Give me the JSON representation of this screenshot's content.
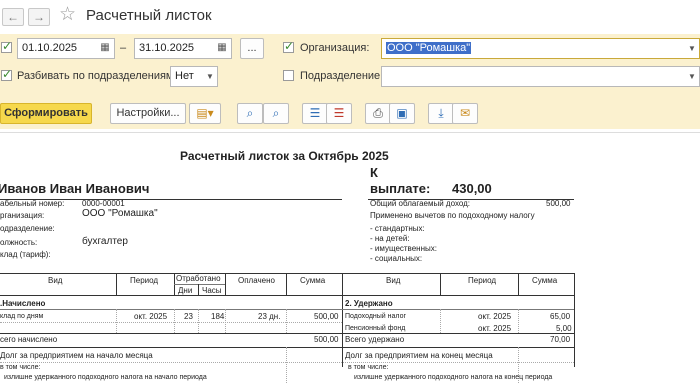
{
  "window": {
    "title": "Расчетный листок"
  },
  "nav": {
    "back": "←",
    "forward": "→",
    "star": "☆"
  },
  "params": {
    "date_from": "01.10.2025",
    "date_to": "31.10.2025",
    "dash": "–",
    "period_more": "...",
    "org_label": "Организация:",
    "org_value": "ООО \"Ромашка\"",
    "split_label": "Разбивать по подразделениям:",
    "split_value": "Нет",
    "dept_label": "Подразделение:",
    "dept_value": ""
  },
  "toolbar": {
    "generate": "Сформировать",
    "settings": "Настройки...",
    "icons": [
      "variants-icon",
      "search-icon",
      "search-next-icon",
      "expand-groups-icon",
      "collapse-groups-icon",
      "print-icon",
      "preview-icon",
      "save-icon",
      "email-icon"
    ]
  },
  "report": {
    "header": "Расчетный листок за Октябрь 2025",
    "employee": "Иванов Иван Иванович",
    "to_pay_k": "К",
    "to_pay_label": "выплате:",
    "to_pay_value": "430,00",
    "info_labels": [
      "абельный номер:",
      "рганизация:",
      "одразделение:",
      "олжность:",
      "клад (тариф):"
    ],
    "info_values": [
      "0000-00001",
      "ООО \"Ромашка\"",
      "",
      "бухгалтер",
      ""
    ],
    "taxable_label": "Общий облагаемый доход:",
    "taxable_value": "500,00",
    "deductions_title": "Применено вычетов по подоходному налогу",
    "deductions": [
      "- стандартных:",
      "- на детей:",
      "- имущественных:",
      "- социальных:"
    ],
    "cols_left": {
      "type": "Вид",
      "period": "Период",
      "worked": "Отработано",
      "days": "Дни",
      "hours": "Часы",
      "paid": "Оплачено",
      "sum": "Сумма"
    },
    "cols_right": {
      "type": "Вид",
      "period": "Период",
      "sum": "Сумма"
    },
    "accrued_title": ".Начислено",
    "accrued": [
      {
        "type": "клад по дням",
        "period": "окт. 2025",
        "days": "23",
        "hours": "184",
        "paid": "23 дн.",
        "sum": "500,00"
      }
    ],
    "accrued_total_label": "сего начислено",
    "accrued_total": "500,00",
    "withheld_title": "2. Удержано",
    "withheld": [
      {
        "type": "Подоходный налог",
        "period": "окт. 2025",
        "sum": "65,00"
      },
      {
        "type": "Пенсионный фонд",
        "period": "окт. 2025",
        "sum": "5,00"
      }
    ],
    "withheld_total_label": "Всего удержано",
    "withheld_total": "70,00",
    "debt_start": "Долг за предприятием на начало месяца",
    "debt_start_sub1": "в том числе:",
    "debt_start_sub2": "излишне удержанного подоходного налога на начало периода",
    "debt_end": "Долг за предприятием на конец месяца",
    "debt_end_sub1": "в том числе:",
    "debt_end_sub2": "излишне удержанного подоходного налога на конец периода"
  }
}
